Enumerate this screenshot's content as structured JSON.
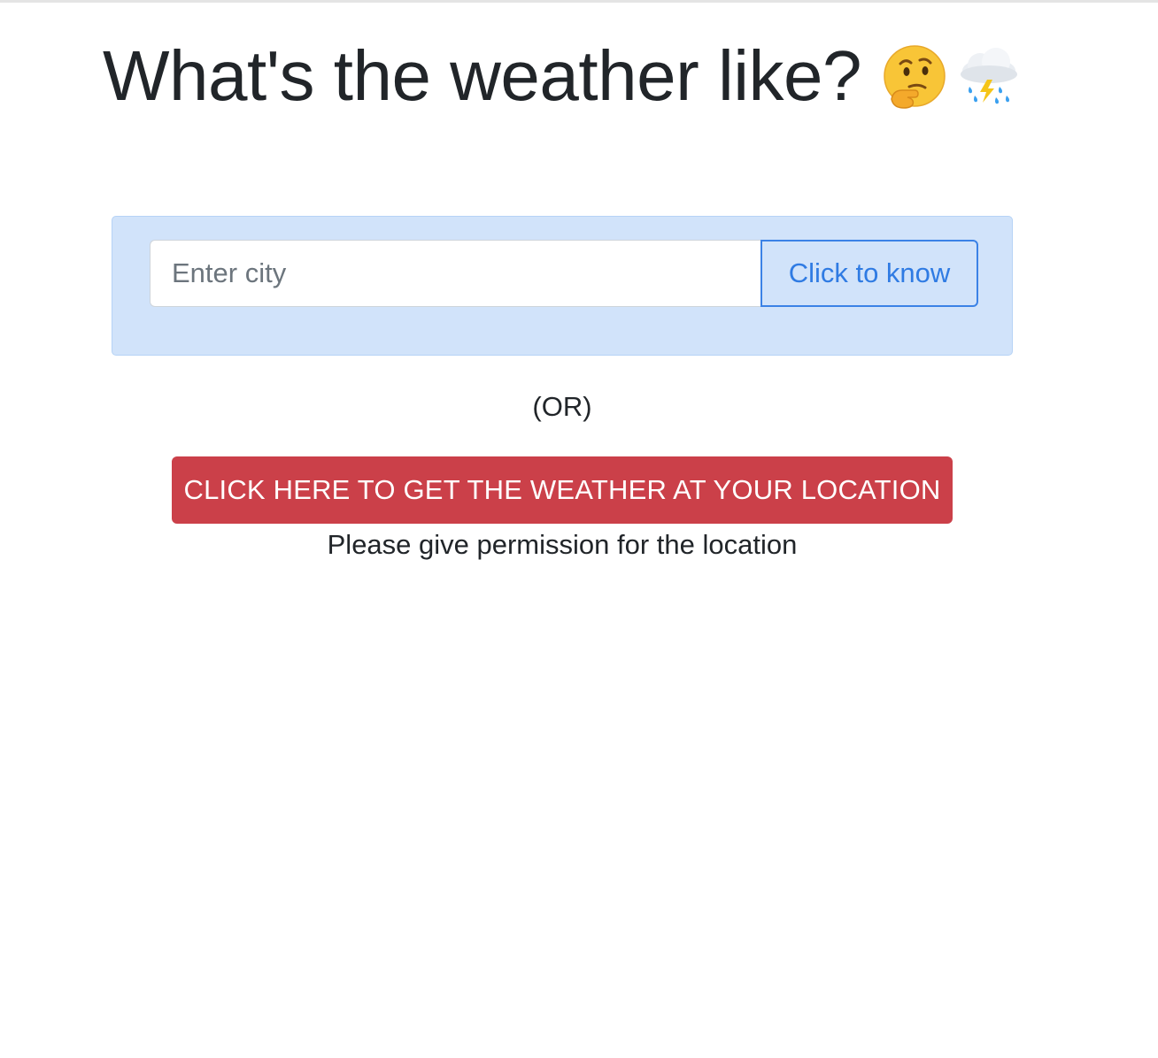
{
  "header": {
    "title": "What's the weather like?",
    "icons": [
      "thinking-face-emoji",
      "cloud-with-lightning-and-rain-emoji"
    ]
  },
  "search": {
    "placeholder": "Enter city",
    "value": "",
    "button_label": "Click to know"
  },
  "separator": {
    "text": "(OR)"
  },
  "location": {
    "button_label": "CLICK HERE TO GET THE WEATHER AT YOUR LOCATION",
    "note": "Please give permission for the location"
  },
  "colors": {
    "card_background": "#d1e3fa",
    "primary_outline": "#3b82e6",
    "danger": "#cb4049",
    "text": "#212529"
  }
}
